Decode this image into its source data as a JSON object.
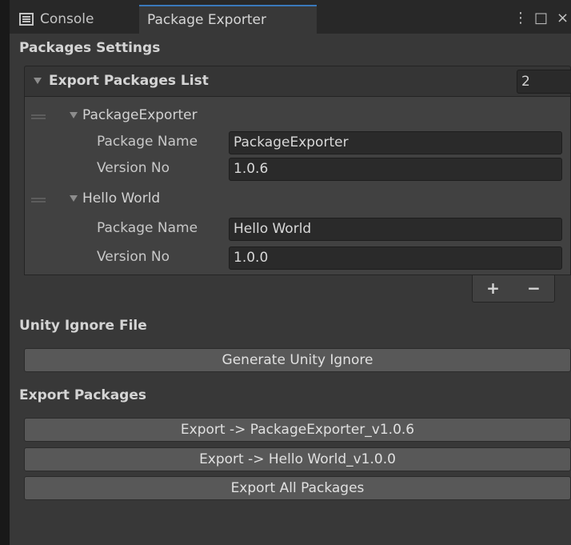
{
  "tabs": {
    "console_label": "Console",
    "exporter_label": "Package Exporter"
  },
  "window_controls": {
    "menu": "⋮",
    "maximize": "□",
    "close": "×"
  },
  "packages_settings": {
    "title": "Packages Settings",
    "list_title": "Export Packages List",
    "list_count": "2",
    "items": [
      {
        "foldout": "PackageExporter",
        "name_label": "Package Name",
        "name_value": "PackageExporter",
        "version_label": "Version No",
        "version_value": "1.0.6"
      },
      {
        "foldout": "Hello World",
        "name_label": "Package Name",
        "name_value": "Hello World",
        "version_label": "Version No",
        "version_value": "1.0.0"
      }
    ],
    "add": "+",
    "remove": "−"
  },
  "unity_ignore": {
    "title": "Unity Ignore File",
    "generate_button": "Generate Unity Ignore"
  },
  "export_packages": {
    "title": "Export Packages",
    "buttons": [
      "Export -> PackageExporter_v1.0.6",
      "Export -> Hello World_v1.0.0",
      "Export All Packages"
    ]
  }
}
